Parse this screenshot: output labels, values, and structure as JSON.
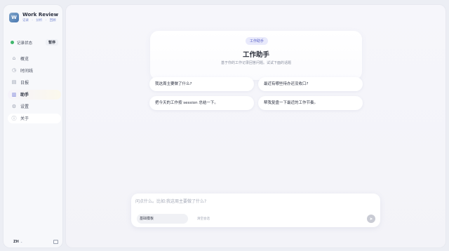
{
  "brand": {
    "logo": "W",
    "title": "Work Review",
    "sub": "记录 · 分析 · 回顾"
  },
  "record": {
    "label": "记录状态",
    "pause_label": "暂停",
    "status_color": "#3fb66c"
  },
  "nav": [
    {
      "label": "概览",
      "icon": "home-icon",
      "glyph": "⌂"
    },
    {
      "label": "时间线",
      "icon": "clock-icon",
      "glyph": "◷"
    },
    {
      "label": "日报",
      "icon": "document-icon",
      "glyph": "▤"
    },
    {
      "label": "助手",
      "icon": "assistant-icon",
      "glyph": "▥",
      "active": true
    },
    {
      "label": "设置",
      "icon": "gear-icon",
      "glyph": "⚙"
    },
    {
      "label": "关于",
      "icon": "info-icon",
      "glyph": "ⓘ"
    }
  ],
  "footer": {
    "lang": "ZH",
    "lang_chevron": "⌄"
  },
  "hero": {
    "badge": "工作助手",
    "title": "工作助手",
    "subtitle": "基于你的工作记录回答问题。试试下面的话题"
  },
  "suggestions": [
    "我这周主要做了什么?",
    "最近有哪些待办还没收口?",
    "把今天的工作按 session 总结一下。",
    "帮我复盘一下最近的工作节奏。"
  ],
  "composer": {
    "placeholder": "问点什么。比如:我这周主要做了什么?",
    "mode_label": "基础模板",
    "clear_label": "清空会话",
    "send_glyph": "➤"
  },
  "colors": {
    "accent": "#5b63c8",
    "badge_bg": "#e8e9fb"
  }
}
